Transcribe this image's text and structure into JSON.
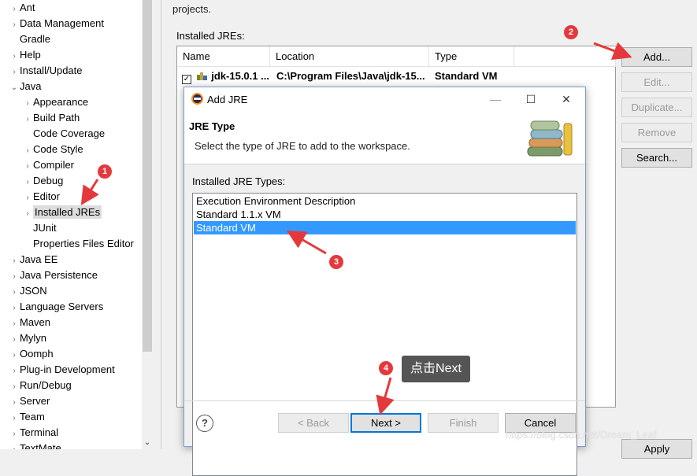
{
  "tree": {
    "items": [
      {
        "label": "Ant",
        "arrow": "›"
      },
      {
        "label": "Data Management",
        "arrow": "›"
      },
      {
        "label": "Gradle",
        "arrow": ""
      },
      {
        "label": "Help",
        "arrow": "›"
      },
      {
        "label": "Install/Update",
        "arrow": "›"
      },
      {
        "label": "Java",
        "arrow": "⌄"
      },
      {
        "label": "Appearance",
        "arrow": "›"
      },
      {
        "label": "Build Path",
        "arrow": "›"
      },
      {
        "label": "Code Coverage",
        "arrow": ""
      },
      {
        "label": "Code Style",
        "arrow": "›"
      },
      {
        "label": "Compiler",
        "arrow": "›"
      },
      {
        "label": "Debug",
        "arrow": "›"
      },
      {
        "label": "Editor",
        "arrow": "›"
      },
      {
        "label": "Installed JREs",
        "arrow": "›"
      },
      {
        "label": "JUnit",
        "arrow": ""
      },
      {
        "label": "Properties Files Editor",
        "arrow": ""
      },
      {
        "label": "Java EE",
        "arrow": "›"
      },
      {
        "label": "Java Persistence",
        "arrow": "›"
      },
      {
        "label": "JSON",
        "arrow": "›"
      },
      {
        "label": "Language Servers",
        "arrow": "›"
      },
      {
        "label": "Maven",
        "arrow": "›"
      },
      {
        "label": "Mylyn",
        "arrow": "›"
      },
      {
        "label": "Oomph",
        "arrow": "›"
      },
      {
        "label": "Plug-in Development",
        "arrow": "›"
      },
      {
        "label": "Run/Debug",
        "arrow": "›"
      },
      {
        "label": "Server",
        "arrow": "›"
      },
      {
        "label": "Team",
        "arrow": "›"
      },
      {
        "label": "Terminal",
        "arrow": "›"
      },
      {
        "label": "TextMate",
        "arrow": "›"
      }
    ],
    "scroll_down": "⌄"
  },
  "page": {
    "description_tail": "projects.",
    "installed_label": "Installed JREs:",
    "columns": [
      "Name",
      "Location",
      "Type"
    ],
    "row": {
      "checked": "✓",
      "name": "jdk-15.0.1 ...",
      "location": "C:\\Program Files\\Java\\jdk-15...",
      "type": "Standard VM"
    },
    "buttons": {
      "add": "Add...",
      "edit": "Edit...",
      "duplicate": "Duplicate...",
      "remove": "Remove",
      "search": "Search..."
    },
    "apply": "Apply"
  },
  "dialog": {
    "title": "Add JRE",
    "minimize": "—",
    "maximize": "☐",
    "close": "✕",
    "header_title": "JRE Type",
    "header_desc": "Select the type of JRE to add to the workspace.",
    "types_label": "Installed JRE Types:",
    "types": [
      "Execution Environment Description",
      "Standard 1.1.x VM",
      "Standard VM"
    ],
    "selected_type": "Standard VM",
    "help": "?",
    "buttons": {
      "back": "< Back",
      "next": "Next >",
      "finish": "Finish",
      "cancel": "Cancel"
    }
  },
  "annotations": {
    "badges": [
      "1",
      "2",
      "3",
      "4"
    ],
    "tooltip": "点击Next",
    "color": "#e4393c"
  },
  "watermark": "https://blog.csdn.net/Dream_Leaf"
}
